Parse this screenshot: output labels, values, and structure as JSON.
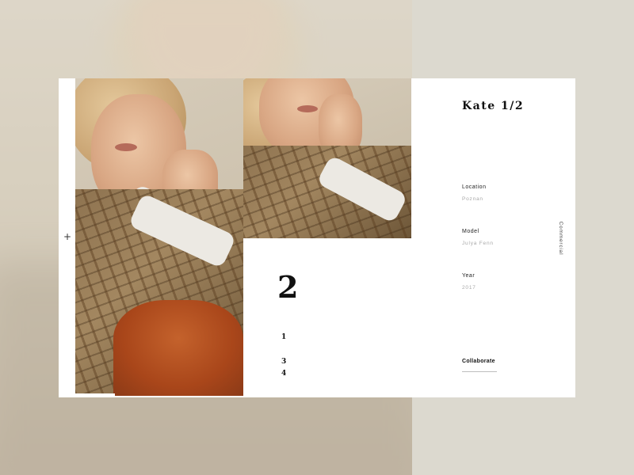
{
  "project": {
    "title": "Kate 1/2",
    "category": "Commercial"
  },
  "info": [
    {
      "label": "Location",
      "value": "Poznan"
    },
    {
      "label": "Model",
      "value": "Julya Fenn"
    },
    {
      "label": "Year",
      "value": "2017"
    }
  ],
  "slider": {
    "current": "2",
    "pages": [
      "1",
      "3",
      "4"
    ]
  },
  "actions": {
    "collaborate": "Collaborate",
    "expand_icon": "plus-icon"
  },
  "colors": {
    "background": "#dad6cb",
    "card": "#ffffff",
    "text": "#111111",
    "muted": "#a8a8a8"
  }
}
